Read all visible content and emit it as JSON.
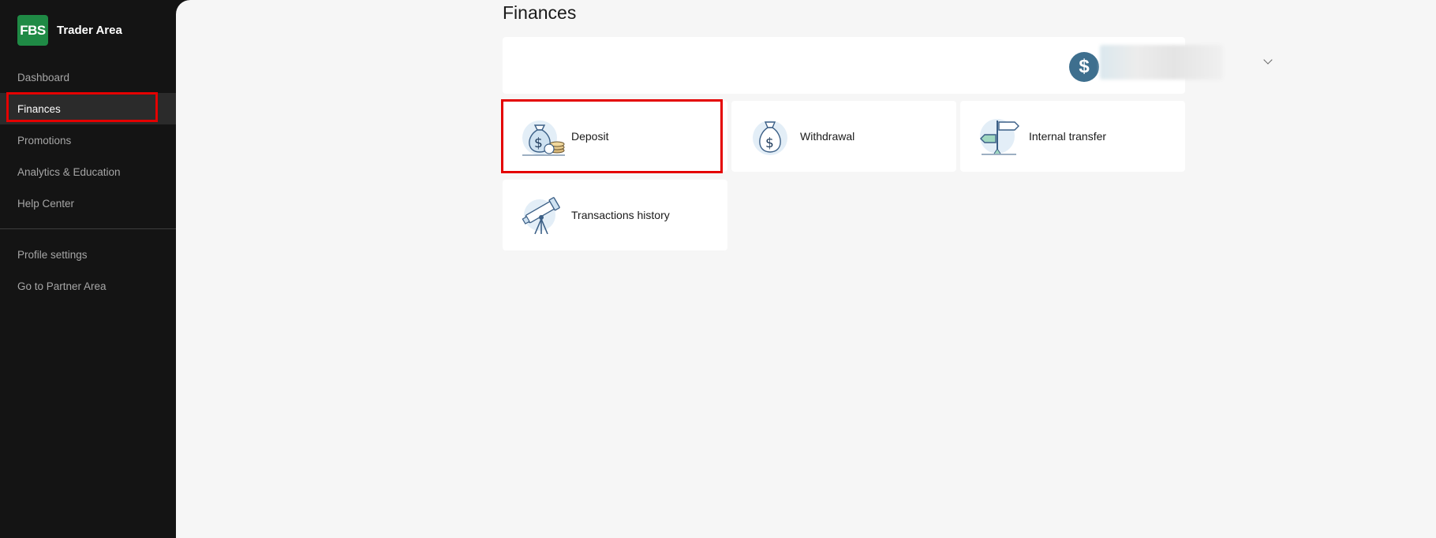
{
  "brand": {
    "logo_text": "FBS",
    "app_name": "Trader Area"
  },
  "sidebar": {
    "items": [
      {
        "label": "Dashboard",
        "active": false
      },
      {
        "label": "Finances",
        "active": true
      },
      {
        "label": "Promotions",
        "active": false
      },
      {
        "label": "Analytics & Education",
        "active": false
      },
      {
        "label": "Help Center",
        "active": false
      }
    ],
    "secondary_items": [
      {
        "label": "Profile settings"
      },
      {
        "label": "Go to Partner Area"
      }
    ]
  },
  "page": {
    "title": "Finances"
  },
  "account_selector": {
    "currency_symbol": "$",
    "icon": "dollar-circle-icon"
  },
  "cards": [
    {
      "label": "Deposit",
      "icon": "money-bag-coins-icon",
      "highlighted": true
    },
    {
      "label": "Withdrawal",
      "icon": "money-bag-icon",
      "highlighted": false
    },
    {
      "label": "Internal transfer",
      "icon": "signpost-icon",
      "highlighted": false
    },
    {
      "label": "Transactions history",
      "icon": "telescope-icon",
      "highlighted": false
    }
  ],
  "colors": {
    "brand_green": "#1f8a45",
    "highlight_red": "#e40000",
    "account_icon_bg": "#3e6f8e",
    "sidebar_bg": "#141414",
    "main_bg": "#f6f6f6"
  }
}
